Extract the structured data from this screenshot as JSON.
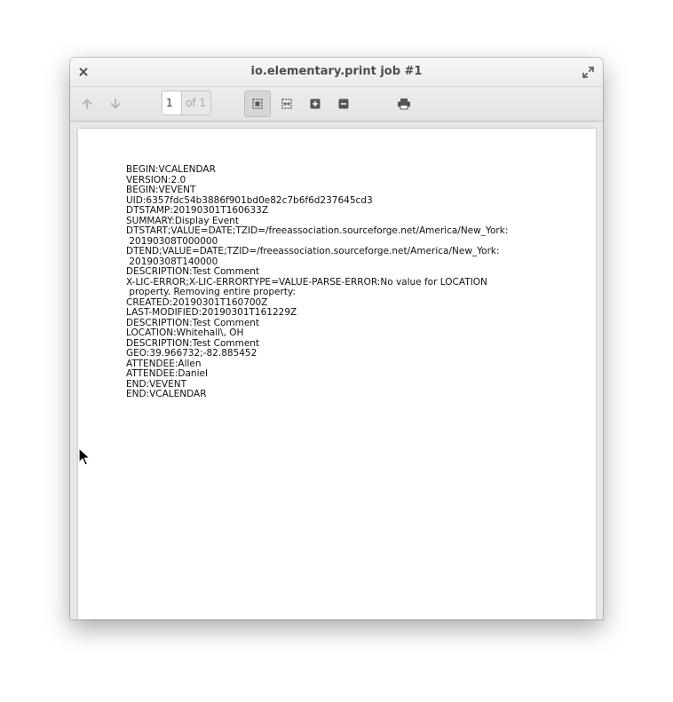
{
  "window": {
    "title": "io.elementary.print job #1"
  },
  "titlebar": {
    "close_icon": "close-icon",
    "maximize_icon": "maximize-icon"
  },
  "toolbar": {
    "previous_icon": "arrow-up-icon",
    "next_icon": "arrow-down-icon",
    "page_value": "1",
    "page_of": "of 1",
    "zoom_fit_page_icon": "zoom-fit-page-icon",
    "zoom_fit_width_icon": "zoom-fit-width-icon",
    "zoom_in_icon": "zoom-in-icon",
    "zoom_out_icon": "zoom-out-icon",
    "print_icon": "printer-icon"
  },
  "document": {
    "lines": [
      "BEGIN:VCALENDAR",
      "VERSION:2.0",
      "BEGIN:VEVENT",
      "UID:6357fdc54b3886f901bd0e82c7b6f6d237645cd3",
      "DTSTAMP:20190301T160633Z",
      "SUMMARY:Display Event",
      "DTSTART;VALUE=DATE;TZID=/freeassociation.sourceforge.net/America/New_York:",
      " 20190308T000000",
      "DTEND;VALUE=DATE;TZID=/freeassociation.sourceforge.net/America/New_York:",
      " 20190308T140000",
      "DESCRIPTION:Test Comment",
      "X-LIC-ERROR;X-LIC-ERRORTYPE=VALUE-PARSE-ERROR:No value for LOCATION",
      " property. Removing entire property:",
      "CREATED:20190301T160700Z",
      "LAST-MODIFIED:20190301T161229Z",
      "DESCRIPTION:Test Comment",
      "LOCATION:Whitehall\\, OH",
      "DESCRIPTION:Test Comment",
      "GEO:39.966732;-82.885452",
      "ATTENDEE:Allen",
      "ATTENDEE:Daniel",
      "END:VEVENT",
      "END:VCALENDAR"
    ]
  },
  "colors": {
    "window_bg": "#f0f0f0",
    "content_bg": "#e7e7e7",
    "page_bg": "#ffffff",
    "text": "#111111",
    "title_text": "#4d4d4d",
    "icon": "#555555",
    "icon_disabled": "#b3b3b3"
  }
}
